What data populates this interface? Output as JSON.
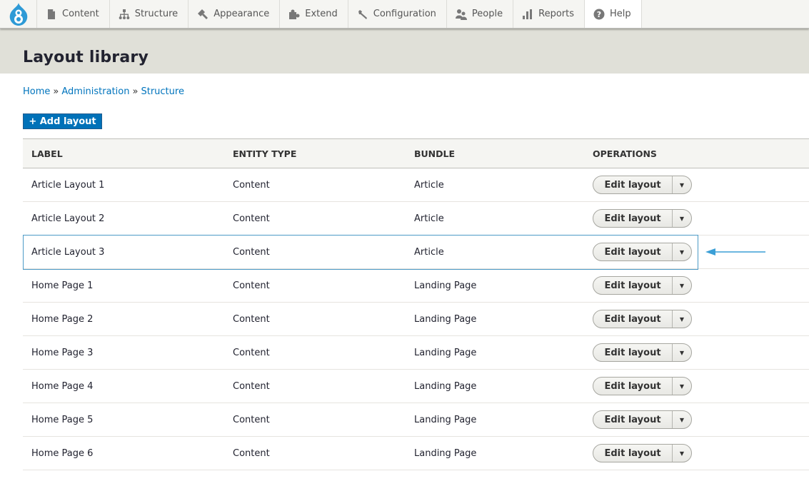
{
  "toolbar": {
    "logo": "drupal-logo",
    "items": [
      {
        "label": "Content",
        "icon": "file-icon"
      },
      {
        "label": "Structure",
        "icon": "sitemap-icon"
      },
      {
        "label": "Appearance",
        "icon": "paintbrush-icon"
      },
      {
        "label": "Extend",
        "icon": "puzzle-icon"
      },
      {
        "label": "Configuration",
        "icon": "wrench-icon"
      },
      {
        "label": "People",
        "icon": "people-icon"
      },
      {
        "label": "Reports",
        "icon": "bar-chart-icon"
      },
      {
        "label": "Help",
        "icon": "help-icon"
      }
    ]
  },
  "page": {
    "title": "Layout library"
  },
  "breadcrumb": {
    "items": [
      "Home",
      "Administration",
      "Structure"
    ],
    "separator": "»"
  },
  "actions": {
    "add_label": "+ Add layout"
  },
  "table": {
    "headers": [
      "LABEL",
      "ENTITY TYPE",
      "BUNDLE",
      "OPERATIONS"
    ],
    "rows": [
      {
        "label": "Article Layout 1",
        "entity_type": "Content",
        "bundle": "Article",
        "operation": "Edit layout"
      },
      {
        "label": "Article Layout 2",
        "entity_type": "Content",
        "bundle": "Article",
        "operation": "Edit layout"
      },
      {
        "label": "Article Layout 3",
        "entity_type": "Content",
        "bundle": "Article",
        "operation": "Edit layout",
        "highlighted": true
      },
      {
        "label": "Home Page 1",
        "entity_type": "Content",
        "bundle": "Landing Page",
        "operation": "Edit layout"
      },
      {
        "label": "Home Page 2",
        "entity_type": "Content",
        "bundle": "Landing Page",
        "operation": "Edit layout"
      },
      {
        "label": "Home Page 3",
        "entity_type": "Content",
        "bundle": "Landing Page",
        "operation": "Edit layout"
      },
      {
        "label": "Home Page 4",
        "entity_type": "Content",
        "bundle": "Landing Page",
        "operation": "Edit layout"
      },
      {
        "label": "Home Page 5",
        "entity_type": "Content",
        "bundle": "Landing Page",
        "operation": "Edit layout"
      },
      {
        "label": "Home Page 6",
        "entity_type": "Content",
        "bundle": "Landing Page",
        "operation": "Edit layout"
      }
    ]
  },
  "colors": {
    "link": "#0074bd",
    "primary_button": "#0071b8",
    "highlight": "#4c9ac6",
    "annotation_arrow": "#3b9fd6",
    "logo": "#2e9ad6"
  }
}
